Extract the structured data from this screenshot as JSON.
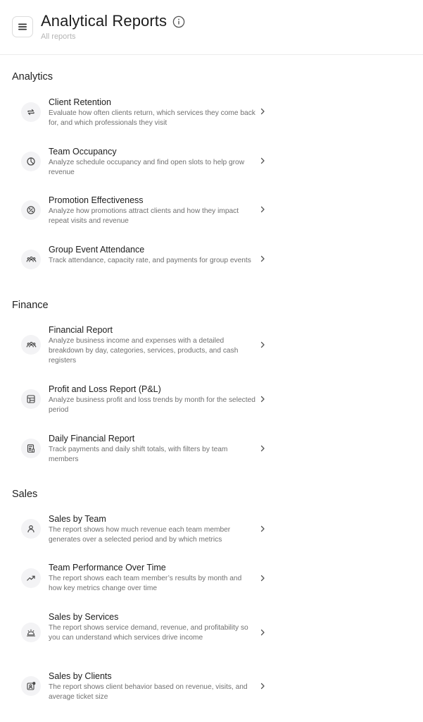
{
  "header": {
    "title": "Analytical Reports",
    "subtitle": "All reports",
    "menu_icon": "hamburger-icon",
    "info_icon": "info-icon"
  },
  "sections": [
    {
      "title": "Analytics",
      "items": [
        {
          "title": "Client Retention",
          "description": "Evaluate how often clients return, which services they come back for, and which professionals they visit",
          "icon": "refresh-icon"
        },
        {
          "title": "Team Occupancy",
          "description": "Analyze schedule occupancy and find open slots to help grow revenue",
          "icon": "pie-chart-icon"
        },
        {
          "title": "Promotion Effectiveness",
          "description": "Analyze how promotions attract clients and how they impact repeat visits and revenue",
          "icon": "discount-icon"
        },
        {
          "title": "Group Event Attendance",
          "description": "Track attendance, capacity rate, and payments for group events",
          "icon": "group-icon"
        }
      ]
    },
    {
      "title": "Finance",
      "items": [
        {
          "title": "Financial Report",
          "description": "Analyze business income and expenses with a detailed breakdown by day, categories, services, products, and cash registers",
          "icon": "group-icon"
        },
        {
          "title": "Profit and Loss Report (P&L)",
          "description": "Analyze business profit and loss trends by month for the selected period",
          "icon": "table-icon"
        },
        {
          "title": "Daily Financial Report",
          "description": "Track payments and daily shift totals, with filters by team members",
          "icon": "calculator-icon"
        }
      ]
    },
    {
      "title": "Sales",
      "items": [
        {
          "title": "Sales by Team",
          "description": "The report shows how much revenue each team member generates over a selected period and by which metrics",
          "icon": "user-icon"
        },
        {
          "title": "Team Performance Over Time",
          "description": "The report shows each team member’s results by month and how key metrics change over time",
          "icon": "trend-up-icon"
        },
        {
          "title": "Sales by Services",
          "description": "The report shows service demand, revenue, and profitability so you can understand which services drive income",
          "icon": "service-bell-icon"
        },
        {
          "title": "Sales by Clients",
          "description": "The report shows client behavior based on revenue, visits, and average ticket size",
          "icon": "client-card-icon"
        }
      ]
    }
  ]
}
